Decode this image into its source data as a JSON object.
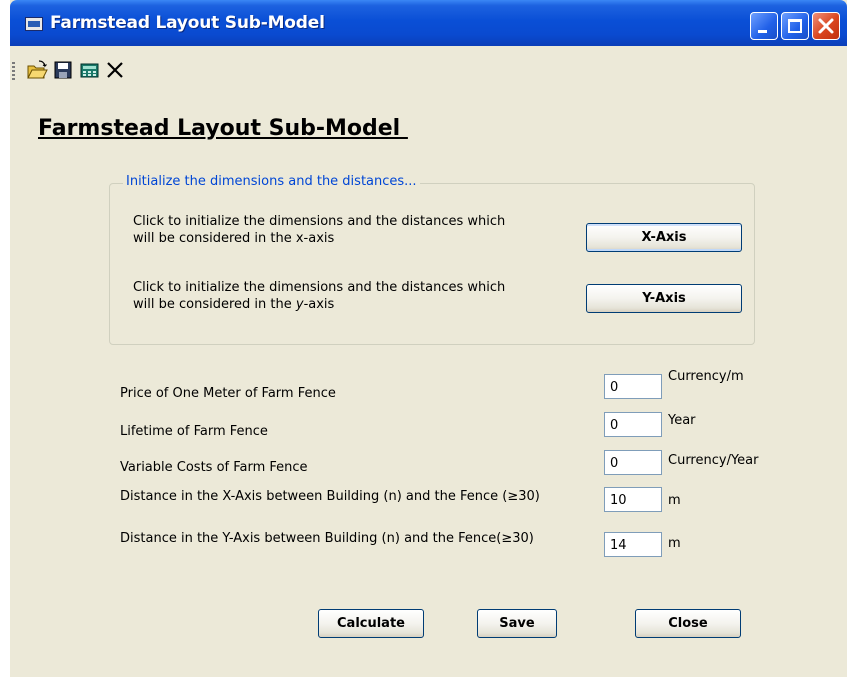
{
  "window": {
    "title": "Farmstead Layout Sub-Model"
  },
  "toolbar": {
    "icons": [
      "open-folder-icon",
      "save-disk-icon",
      "calculator-icon",
      "close-x-icon"
    ]
  },
  "main": {
    "heading": "Farmstead Layout Sub-Model ",
    "group": {
      "legend": "Initialize the dimensions and the distances...",
      "x_line1": "Click to initialize the dimensions and the distances which",
      "x_line2": "will be considered in the x-axis",
      "x_button": "X-Axis",
      "y_line1": "Click to initialize the dimensions and the distances which",
      "y_line2_pre": "will be considered in the ",
      "y_line2_italic": "y",
      "y_line2_post": "-axis",
      "y_button": "Y-Axis"
    },
    "fields": [
      {
        "label": "Price of One Meter of Farm Fence",
        "value": "0",
        "unit": "Currency/m"
      },
      {
        "label": "Lifetime of Farm Fence",
        "value": "0",
        "unit": "Year"
      },
      {
        "label": "Variable Costs of Farm Fence",
        "value": "0",
        "unit": "Currency/Year"
      },
      {
        "label": "Distance in the X-Axis between Building (n) and the Fence (≥30)",
        "value": "10",
        "unit": "m"
      },
      {
        "label": "Distance in the Y-Axis between Building (n) and the Fence(≥30)",
        "value": "14",
        "unit": "m"
      }
    ],
    "buttons": {
      "calculate": "Calculate",
      "save": "Save",
      "close": "Close"
    }
  },
  "colors": {
    "titlebar": "#0a4ad0",
    "window_bg": "#ece9d8",
    "legend_text": "#0046d5",
    "button_border": "#003c74"
  }
}
